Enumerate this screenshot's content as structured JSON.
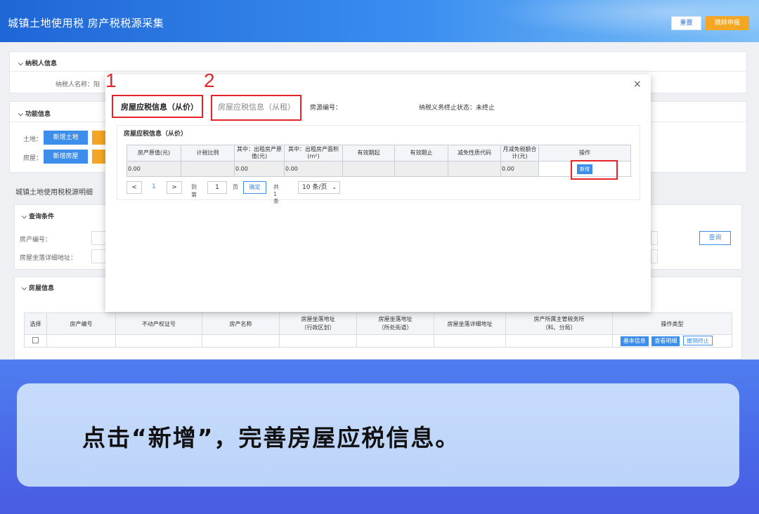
{
  "header": {
    "title": "城镇土地使用税 房产税税源采集",
    "reset_label": "重置",
    "jump_label": "跳转申报"
  },
  "taxpayer": {
    "section_title": "纳税人信息",
    "name_label": "纳税人名称：阳"
  },
  "function": {
    "section_title": "功能信息",
    "land_label": "土地：",
    "add_land": "新增土地",
    "house_label": "房屋：",
    "add_house": "新增房屋"
  },
  "detail": {
    "title": "城镇土地使用税税源明细",
    "query_title": "查询条件",
    "property_no_label": "房产编号：",
    "address_label": "房屋坐落详细地址：",
    "query_button": "查询",
    "house_section": "房屋信息",
    "columns": [
      "选择",
      "房产编号",
      "不动产权证号",
      "房产名称",
      "房屋坐落地址\n（行政区划）",
      "房屋坐落地址\n（所处街道）",
      "房屋坐落详细地址",
      "房产所属主管税务所\n（科、分局）",
      "操作类型"
    ],
    "row_actions": [
      "基本信息",
      "查看明细",
      "撤销终止"
    ]
  },
  "modal": {
    "close": "×",
    "tab_active": "房屋应税信息（从价）",
    "tab_inactive": "房屋应税信息（从租）",
    "source_no": "房源编号：",
    "end_status": "纳税义务终止状态：未终止",
    "inner_title": "房屋应税信息（从价）",
    "columns": [
      "房产原值(元)",
      "计税比例",
      "其中：出租房产原值(元)",
      "其中：出租房产面积(m²)",
      "有效期起",
      "有效期止",
      "减免性质代码",
      "月减免税额合计(元)",
      "操作"
    ],
    "row": [
      "0.00",
      "",
      "0.00",
      "0.00",
      "",
      "",
      "",
      "0.00"
    ],
    "add_button": "新增",
    "pager": {
      "prev": "<",
      "page": "1",
      "next": ">",
      "goto": "到第",
      "page_input": "1",
      "page_unit": "页",
      "confirm": "确定",
      "total": "共 1 条",
      "size": "10 条/页"
    }
  },
  "annotations": {
    "num1": "1",
    "num2": "2"
  },
  "caption": "点击“新增”，完善房屋应税信息。"
}
